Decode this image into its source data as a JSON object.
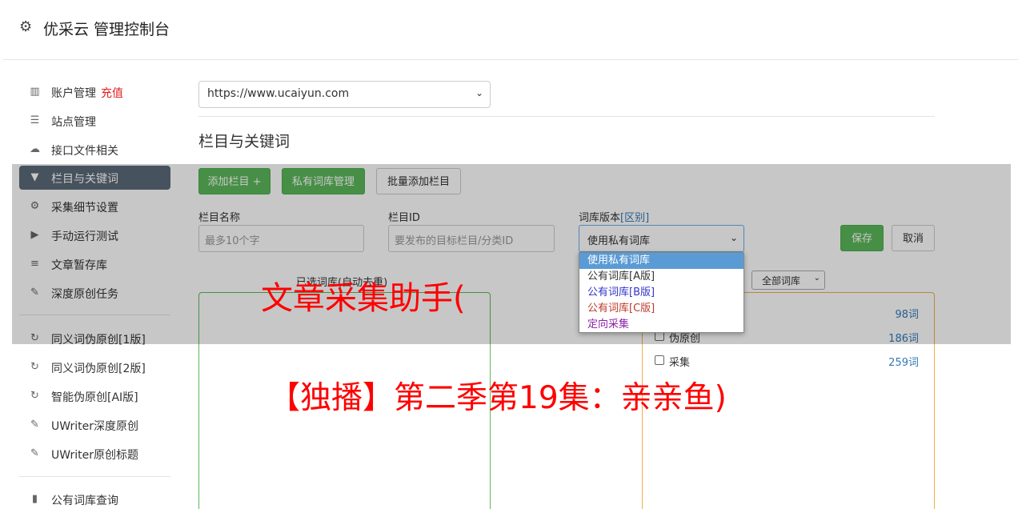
{
  "header": {
    "gear_icon": "gear-icon",
    "title": "优采云 管理控制台"
  },
  "sidebar": {
    "items": [
      {
        "icon": "bar-chart-icon",
        "label": "账户管理",
        "tag": "充值"
      },
      {
        "icon": "server-icon",
        "label": "站点管理"
      },
      {
        "icon": "cloud-upload-icon",
        "label": "接口文件相关"
      },
      {
        "icon": "filter-icon",
        "label": "栏目与关键词",
        "active": true
      },
      {
        "icon": "cogs-icon",
        "label": "采集细节设置"
      },
      {
        "icon": "play-icon",
        "label": "手动运行测试"
      },
      {
        "icon": "database-icon",
        "label": "文章暂存库"
      },
      {
        "icon": "edit-icon",
        "label": "深度原创任务"
      },
      {
        "icon": "refresh-icon",
        "label": "同义词伪原创[1版]"
      },
      {
        "icon": "refresh-icon",
        "label": "同义词伪原创[2版]"
      },
      {
        "icon": "refresh-icon",
        "label": "智能伪原创[AI版]"
      },
      {
        "icon": "edit-icon",
        "label": "UWriter深度原创"
      },
      {
        "icon": "edit-icon",
        "label": "UWriter原创标题"
      },
      {
        "icon": "book-icon",
        "label": "公有词库查询"
      }
    ]
  },
  "main": {
    "site_select_value": "https://www.ucaiyun.com",
    "section_title": "栏目与关键词",
    "buttons": {
      "add_column": "添加栏目 +",
      "private_lib": "私有词库管理",
      "batch_add": "批量添加栏目",
      "save": "保存",
      "cancel": "取消"
    },
    "fields": {
      "column_name_label": "栏目名称",
      "column_name_placeholder": "最多10个字",
      "column_id_label": "栏目ID",
      "column_id_placeholder": "要发布的目标栏目/分类ID",
      "lib_version_label": "词库版本",
      "lib_version_link": "[区别]",
      "lib_version_value": "使用私有词库"
    },
    "dropdown_options": [
      {
        "label": "使用私有词库",
        "selected": true,
        "color": "#ffffff"
      },
      {
        "label": "公有词库[A版]",
        "color": "#333333"
      },
      {
        "label": "公有词库[B版]",
        "color": "#3333cc"
      },
      {
        "label": "公有词库[C版]",
        "color": "#c0392b"
      },
      {
        "label": "定向采集",
        "color": "#8e24aa"
      }
    ],
    "left_panel_caption": "已选词库(自动去重)",
    "filter_select_value": "全部词库",
    "libraries": [
      {
        "name": "",
        "count": "98词"
      },
      {
        "name": "伪原创",
        "count": "186词"
      },
      {
        "name": "采集",
        "count": "259词"
      }
    ]
  },
  "watermark": {
    "line1": "文章采集助手(",
    "line2": "【独播】第二季第19集：亲亲鱼)"
  },
  "colors": {
    "green": "#5cb85c",
    "orange": "#f0ad4e",
    "active_sidebar": "#5a6a78",
    "watermark": "#ff0000",
    "link": "#337ab7"
  }
}
